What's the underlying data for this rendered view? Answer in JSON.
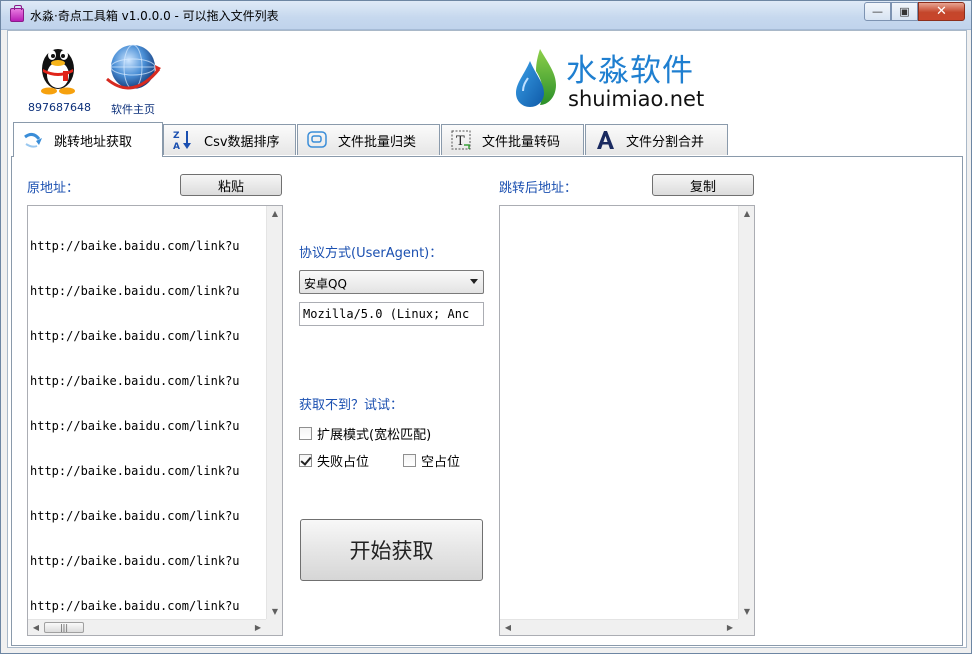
{
  "window": {
    "title": "水淼·奇点工具箱 v1.0.0.0 - 可以拖入文件列表",
    "min_icon": "minimize-icon",
    "max_icon": "maximize-icon",
    "close_icon": "close-icon"
  },
  "header": {
    "qq_label": "897687648",
    "home_label": "软件主页",
    "brand_cn": "水淼软件",
    "brand_en": "shuimiao.net"
  },
  "tabs": [
    {
      "label": "跳转地址获取",
      "icon": "redirect-arrow-icon",
      "active": true
    },
    {
      "label": "Csv数据排序",
      "icon": "sort-az-icon",
      "active": false
    },
    {
      "label": "文件批量归类",
      "icon": "classify-icon",
      "active": false
    },
    {
      "label": "文件批量转码",
      "icon": "text-convert-icon",
      "active": false
    },
    {
      "label": "文件分割合并",
      "icon": "split-merge-icon",
      "active": false
    }
  ],
  "source": {
    "label": "原地址：",
    "paste_button": "粘贴",
    "lines": [
      "http://baike.baidu.com/link?u",
      "http://baike.baidu.com/link?u",
      "http://baike.baidu.com/link?u",
      "http://baike.baidu.com/link?u",
      "http://baike.baidu.com/link?u",
      "http://baike.baidu.com/link?u",
      "http://baike.baidu.com/link?u",
      "http://baike.baidu.com/link?u",
      "http://baike.baidu.com/link?u"
    ]
  },
  "middle": {
    "protocol_label": "协议方式(UserAgent)：",
    "protocol_selected": "安卓QQ",
    "user_agent": "Mozilla/5.0 (Linux; Anc",
    "fallback_label": "获取不到？试试：",
    "option_extended": "扩展模式(宽松匹配)",
    "option_fail_placeholder": "失败占位",
    "option_empty_placeholder": "空占位",
    "start_button": "开始获取"
  },
  "result": {
    "label": "跳转后地址：",
    "copy_button": "复制"
  },
  "state": {
    "extended_checked": false,
    "fail_placeholder_checked": true,
    "empty_placeholder_checked": false
  }
}
